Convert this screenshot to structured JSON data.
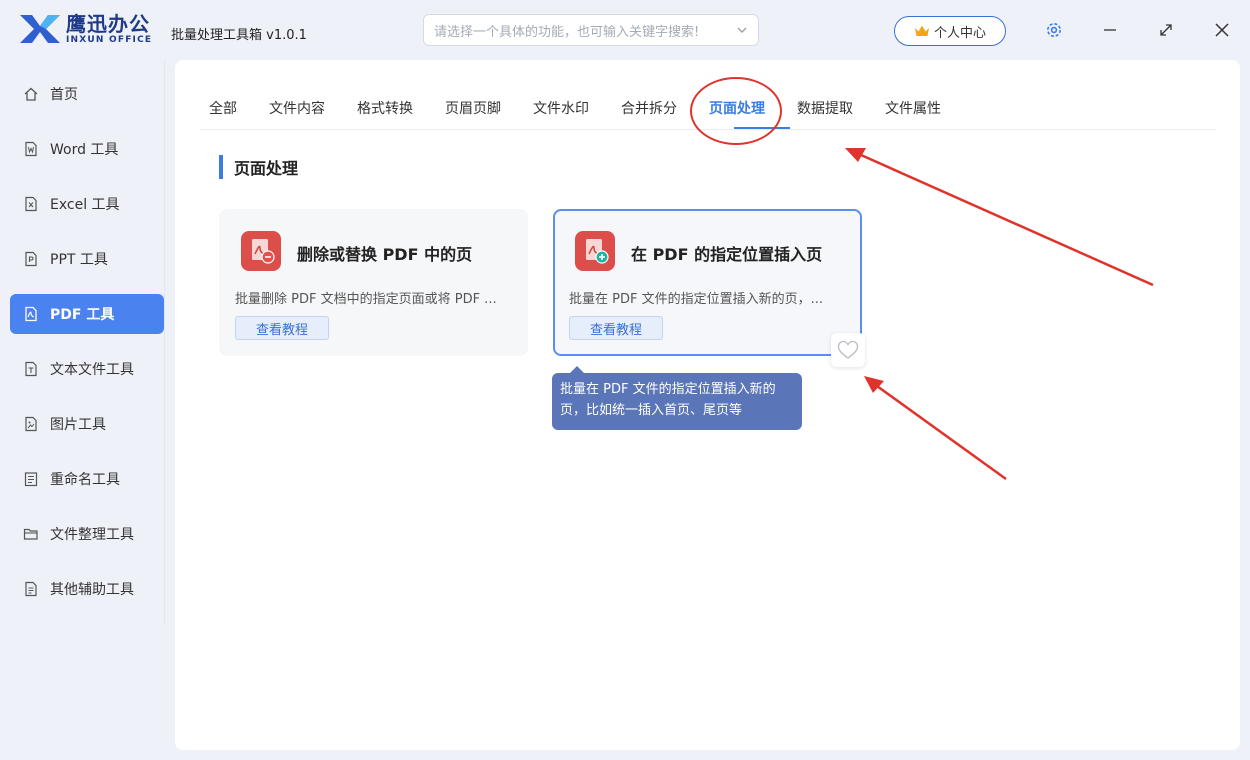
{
  "app": {
    "logo_cn": "鹰迅办公",
    "logo_en": "INXUN OFFICE",
    "title": "批量处理工具箱 v1.0.1"
  },
  "search": {
    "placeholder": "请选择一个具体的功能，也可输入关键字搜索!"
  },
  "header": {
    "user_center_label": "个人中心",
    "accent_color": "#3b7de0"
  },
  "sidebar": {
    "items": [
      {
        "label": "首页",
        "icon": "home-icon"
      },
      {
        "label": "Word 工具",
        "icon": "word-file-icon"
      },
      {
        "label": "Excel 工具",
        "icon": "excel-file-icon"
      },
      {
        "label": "PPT 工具",
        "icon": "ppt-file-icon"
      },
      {
        "label": "PDF 工具",
        "icon": "pdf-file-icon",
        "active": true
      },
      {
        "label": "文本文件工具",
        "icon": "text-file-icon"
      },
      {
        "label": "图片工具",
        "icon": "image-file-icon"
      },
      {
        "label": "重命名工具",
        "icon": "rename-icon"
      },
      {
        "label": "文件整理工具",
        "icon": "folder-icon"
      },
      {
        "label": "其他辅助工具",
        "icon": "tool-file-icon"
      }
    ],
    "active_color": "#4a82f0"
  },
  "tabs": [
    {
      "label": "全部"
    },
    {
      "label": "文件内容"
    },
    {
      "label": "格式转换"
    },
    {
      "label": "页眉页脚"
    },
    {
      "label": "文件水印"
    },
    {
      "label": "合并拆分"
    },
    {
      "label": "页面处理",
      "active": true
    },
    {
      "label": "数据提取"
    },
    {
      "label": "文件属性"
    }
  ],
  "section": {
    "title": "页面处理"
  },
  "cards": [
    {
      "title": "删除或替换 PDF 中的页",
      "description": "批量删除 PDF 文档中的指定页面或将 PDF ...",
      "button_label": "查看教程",
      "icon": "pdf-remove-icon"
    },
    {
      "title": "在 PDF 的指定位置插入页",
      "description": "批量在 PDF 文件的指定位置插入新的页，...",
      "button_label": "查看教程",
      "icon": "pdf-insert-icon",
      "hovered": true
    }
  ],
  "tooltip": {
    "line1": "批量在 PDF 文件的指定位置插入新的",
    "line2": "页，比如统一插入首页、尾页等"
  },
  "colors": {
    "pdf_icon_red": "#dc4e4a",
    "annotation_red": "#e0332b",
    "tooltip_bg": "#5b76b8"
  }
}
